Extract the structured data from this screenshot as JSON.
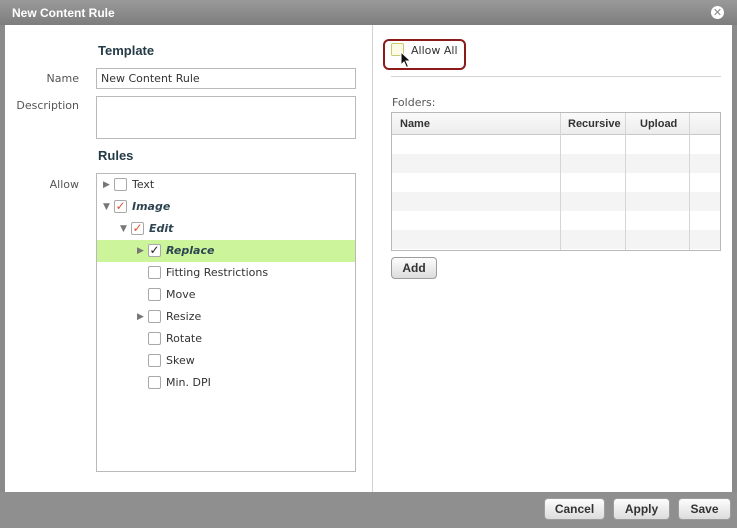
{
  "dialog": {
    "title": "New Content Rule",
    "close_glyph": "✕"
  },
  "template": {
    "heading": "Template",
    "name_label": "Name",
    "name_value": "New Content Rule",
    "description_label": "Description",
    "description_value": ""
  },
  "rules": {
    "heading": "Rules",
    "allow_label": "Allow",
    "tree": [
      {
        "label": "Text",
        "level": 0,
        "expander": "collapsed",
        "checked": false,
        "bold": false,
        "selected": false
      },
      {
        "label": "Image",
        "level": 0,
        "expander": "expanded",
        "checked": true,
        "bold": true,
        "selected": false
      },
      {
        "label": "Edit",
        "level": 1,
        "expander": "expanded",
        "checked": true,
        "bold": true,
        "selected": false
      },
      {
        "label": "Replace",
        "level": 2,
        "expander": "collapsed",
        "checked": true,
        "bold": true,
        "selected": true
      },
      {
        "label": "Fitting Restrictions",
        "level": 2,
        "expander": "none",
        "checked": false,
        "bold": false,
        "selected": false
      },
      {
        "label": "Move",
        "level": 2,
        "expander": "none",
        "checked": false,
        "bold": false,
        "selected": false
      },
      {
        "label": "Resize",
        "level": 2,
        "expander": "collapsed",
        "checked": false,
        "bold": false,
        "selected": false
      },
      {
        "label": "Rotate",
        "level": 2,
        "expander": "none",
        "checked": false,
        "bold": false,
        "selected": false
      },
      {
        "label": "Skew",
        "level": 2,
        "expander": "none",
        "checked": false,
        "bold": false,
        "selected": false
      },
      {
        "label": "Min. DPI",
        "level": 2,
        "expander": "none",
        "checked": false,
        "bold": false,
        "selected": false
      }
    ]
  },
  "right_panel": {
    "allow_all_label": "Allow All",
    "allow_all_checked": false,
    "folders_label": "Folders:",
    "columns": [
      "Name",
      "Recursive",
      "Upload"
    ],
    "rows": [],
    "add_label": "Add"
  },
  "footer": {
    "cancel_label": "Cancel",
    "apply_label": "Apply",
    "save_label": "Save"
  },
  "colors": {
    "selected_row": "#ccf59b",
    "highlight_ring": "#8b1b1b",
    "heading": "#243b46"
  }
}
